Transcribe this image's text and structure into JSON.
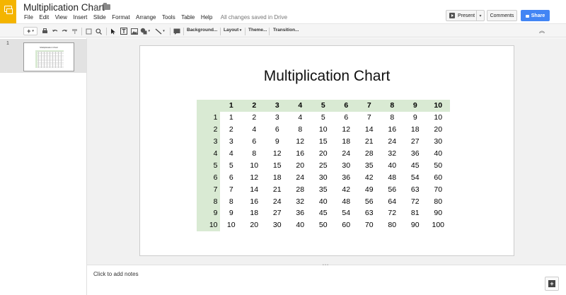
{
  "header": {
    "title": "Multiplication Chart",
    "star_glyph": "☆",
    "menu": [
      "File",
      "Edit",
      "View",
      "Insert",
      "Slide",
      "Format",
      "Arrange",
      "Tools",
      "Table",
      "Help"
    ],
    "save_status": "All changes saved in Drive",
    "present_label": "Present",
    "comments_label": "Comments",
    "share_label": "Share",
    "accent_color": "#f4b400",
    "share_color": "#4285f4"
  },
  "toolbar": {
    "new_label": "+",
    "background_label": "Background...",
    "layout_label": "Layout",
    "theme_label": "Theme...",
    "transition_label": "Transition..."
  },
  "filmstrip": {
    "slide_number": "1",
    "thumb_title": "Multiplication Chart"
  },
  "slide": {
    "title": "Multiplication Chart",
    "table": {
      "col_headers": [
        "1",
        "2",
        "3",
        "4",
        "5",
        "6",
        "7",
        "8",
        "9",
        "10"
      ],
      "row_headers": [
        "1",
        "2",
        "3",
        "4",
        "5",
        "6",
        "7",
        "8",
        "9",
        "10"
      ],
      "rows": [
        [
          "1",
          "2",
          "3",
          "4",
          "5",
          "6",
          "7",
          "8",
          "9",
          "10"
        ],
        [
          "2",
          "4",
          "6",
          "8",
          "10",
          "12",
          "14",
          "16",
          "18",
          "20"
        ],
        [
          "3",
          "6",
          "9",
          "12",
          "15",
          "18",
          "21",
          "24",
          "27",
          "30"
        ],
        [
          "4",
          "8",
          "12",
          "16",
          "20",
          "24",
          "28",
          "32",
          "36",
          "40"
        ],
        [
          "5",
          "10",
          "15",
          "20",
          "25",
          "30",
          "35",
          "40",
          "45",
          "50"
        ],
        [
          "6",
          "12",
          "18",
          "24",
          "30",
          "36",
          "42",
          "48",
          "54",
          "60"
        ],
        [
          "7",
          "14",
          "21",
          "28",
          "35",
          "42",
          "49",
          "56",
          "63",
          "70"
        ],
        [
          "8",
          "16",
          "24",
          "32",
          "40",
          "48",
          "56",
          "64",
          "72",
          "80"
        ],
        [
          "9",
          "18",
          "27",
          "36",
          "45",
          "54",
          "63",
          "72",
          "81",
          "90"
        ],
        [
          "10",
          "20",
          "30",
          "40",
          "50",
          "60",
          "70",
          "80",
          "90",
          "100"
        ]
      ],
      "header_bg": "#d9ead3"
    }
  },
  "notes": {
    "placeholder": "Click to add notes"
  }
}
